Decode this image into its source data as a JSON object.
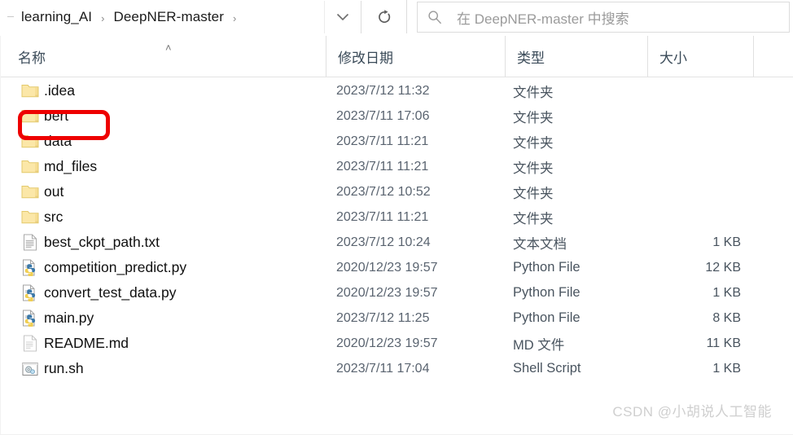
{
  "window": {
    "title": "DeepNER-master"
  },
  "toolbar": {
    "breadcrumb": [
      {
        "label": "learning_AI",
        "icon": "folder-crumb"
      },
      {
        "label": "DeepNER-master",
        "icon": "folder-crumb"
      }
    ],
    "breadcrumb_separator": "›",
    "dropdown_icon": "chevron-down-icon",
    "refresh_icon": "refresh-icon",
    "refresh_glyph": "↻"
  },
  "search": {
    "icon": "search-icon",
    "placeholder": "在 DeepNER-master 中搜索"
  },
  "columns": {
    "name": "名称",
    "date_modified": "修改日期",
    "type": "类型",
    "size": "大小",
    "sort_indicator": "˄",
    "sort_column": "名称",
    "sort_direction": "ascending"
  },
  "files": [
    {
      "name": ".idea",
      "date": "2023/7/12 11:32",
      "type": "文件夹",
      "size": "",
      "icon": "folder-icon"
    },
    {
      "name": "bert",
      "date": "2023/7/11 17:06",
      "type": "文件夹",
      "size": "",
      "icon": "folder-icon"
    },
    {
      "name": "data",
      "date": "2023/7/11 11:21",
      "type": "文件夹",
      "size": "",
      "icon": "folder-icon"
    },
    {
      "name": "md_files",
      "date": "2023/7/11 11:21",
      "type": "文件夹",
      "size": "",
      "icon": "folder-icon"
    },
    {
      "name": "out",
      "date": "2023/7/12 10:52",
      "type": "文件夹",
      "size": "",
      "icon": "folder-icon"
    },
    {
      "name": "src",
      "date": "2023/7/11 11:21",
      "type": "文件夹",
      "size": "",
      "icon": "folder-icon"
    },
    {
      "name": "best_ckpt_path.txt",
      "date": "2023/7/12 10:24",
      "type": "文本文档",
      "size": "1 KB",
      "icon": "text-file-icon"
    },
    {
      "name": "competition_predict.py",
      "date": "2020/12/23 19:57",
      "type": "Python File",
      "size": "12 KB",
      "icon": "python-file-icon"
    },
    {
      "name": "convert_test_data.py",
      "date": "2020/12/23 19:57",
      "type": "Python File",
      "size": "1 KB",
      "icon": "python-file-icon"
    },
    {
      "name": "main.py",
      "date": "2023/7/12 11:25",
      "type": "Python File",
      "size": "8 KB",
      "icon": "python-file-icon"
    },
    {
      "name": "README.md",
      "date": "2020/12/23 19:57",
      "type": "MD 文件",
      "size": "11 KB",
      "icon": "md-file-icon"
    },
    {
      "name": "run.sh",
      "date": "2023/7/11 17:04",
      "type": "Shell Script",
      "size": "1 KB",
      "icon": "shell-script-icon"
    }
  ],
  "annotation": {
    "highlight_target": "bert",
    "color": "#ee0000",
    "shape": "rounded-rectangle"
  },
  "watermark": {
    "text": "CSDN @小胡说人工智能",
    "color": "#cfcfcf"
  }
}
